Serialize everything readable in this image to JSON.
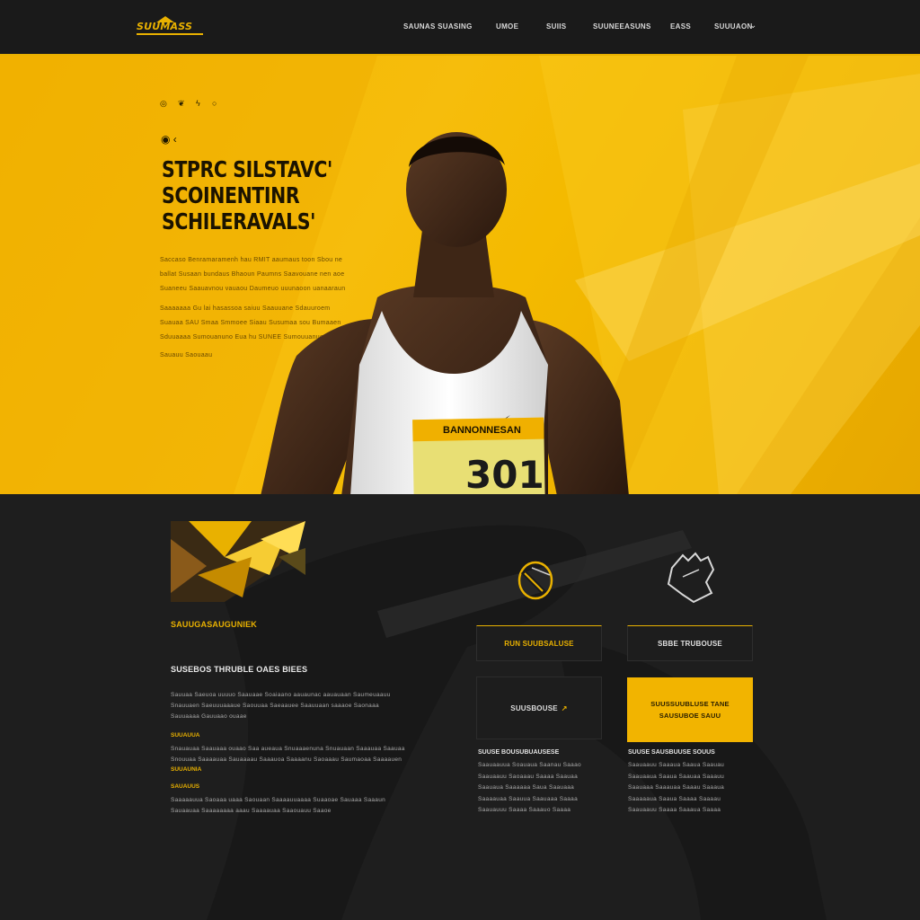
{
  "nav": {
    "logo": "SUUMASS",
    "links": [
      "SAUNAS SUASING",
      "UMOE",
      "SUIIS",
      "SUUNEEASUNS",
      "EASS",
      "SUUUAON"
    ]
  },
  "hero": {
    "social_icons": [
      "globe-icon",
      "leaf-icon",
      "bolt-icon",
      "circle-icon"
    ],
    "title_lines": [
      "STPRC SILSTAVC'",
      "SCOINENTINR",
      "SCHILERAVALS'"
    ],
    "paragraph_1": [
      "Saccaso Benramaramenh hau RMIT aaumaus toon Sbou ne",
      "ballat Susaan bundaus Bhaoun Paumns Saavouane nen aoe",
      "Suaneeu Saauavnou vauaou Daumeuo uuunaoon uanaaraun"
    ],
    "paragraph_2": [
      "Saaaaaaa Gu lai hasassoa saiuu Saauuane Sdauuroem",
      "Suauaa SAU Smaa Smmoee Siaau Susumaa sou Bumaaen",
      "Sduuaaaa Sumouanuno Eua hu SUNEE Sumouuanue"
    ],
    "paragraph_3": "Sauauu Saouaau",
    "bib_text": "BANNONNESAN",
    "bib_number": "301"
  },
  "lower": {
    "feature_label": "SAUUGASAUGUNIEK",
    "feature_title": "SUSEBOS THRUBLE OAES BIEES",
    "body_1": [
      "Sauuaa Saeuoa uuuuo Saauaae Soaiaano aauaunac aauauaan Saumeuaauu",
      "Snauuaen Saeuuuaaaue Saouuaa Saeaauee Saauuaan saaaoe Saonaaa",
      "Sauuaaaa Gauuaao ouaae"
    ],
    "tag_1": "SUUAUUA",
    "body_2": [
      "Snauauaa Saauaaa ouaao Saa aueaua Snuaaaenuna Snuauaan Saaauaa Saauaa",
      "Snouuaa Saaaauaa Sauaaaau Saaauoa Saaaanu Saoaaau Saumaoaa Saaaauen"
    ],
    "tag_2": "SUUAUNIA",
    "tag_3": "SAUAUUS",
    "body_3": [
      "Saaaaauua Saoaaa uaaa Saouaan Saaaauuaaaa Suaaoae Sauaaa Saaaun",
      "Sauaauaa Saaaaaaaa aaau Saaaauaa Saaouauu Saaoe"
    ],
    "col_left": {
      "icon": "ring-icon",
      "button_1": "RUN SUUBSALUSE",
      "button_2": "SUUSBOUSE",
      "heading": "SUUSE BOUSUBUAUSESE",
      "text": [
        "Saauaauua Soauaua Saanau Saaao",
        "Saauaauu Saoaaau Saaaa Saauaa",
        "Saauaua Saaaaaa Saua Saauaaa",
        "Saaaauaa Saauua Saauaaa Saaaa",
        "Saauauuu Saaaa Saaauo Saaaa"
      ]
    },
    "col_right": {
      "icon": "glove-icon",
      "button_1": "SBBE TRUBOUSE",
      "button_2_lines": [
        "SUUSSUUBLUSE TANE",
        "SAUSUBOE SAUU"
      ],
      "heading": "SUUSE SAUSBUUSE SOUUS",
      "text": [
        "Saauaauu Saaaua Saaua Saauau",
        "Saauaaua Saaua Saauaa Saaauu",
        "Saauaaa Saaauaa Saaau Saaaua",
        "Saaaaaua Saaua Saaaa Saaaau",
        "Saauaauu Saaaa Saaaua Saaaa"
      ]
    },
    "accent": "#f2b400"
  }
}
